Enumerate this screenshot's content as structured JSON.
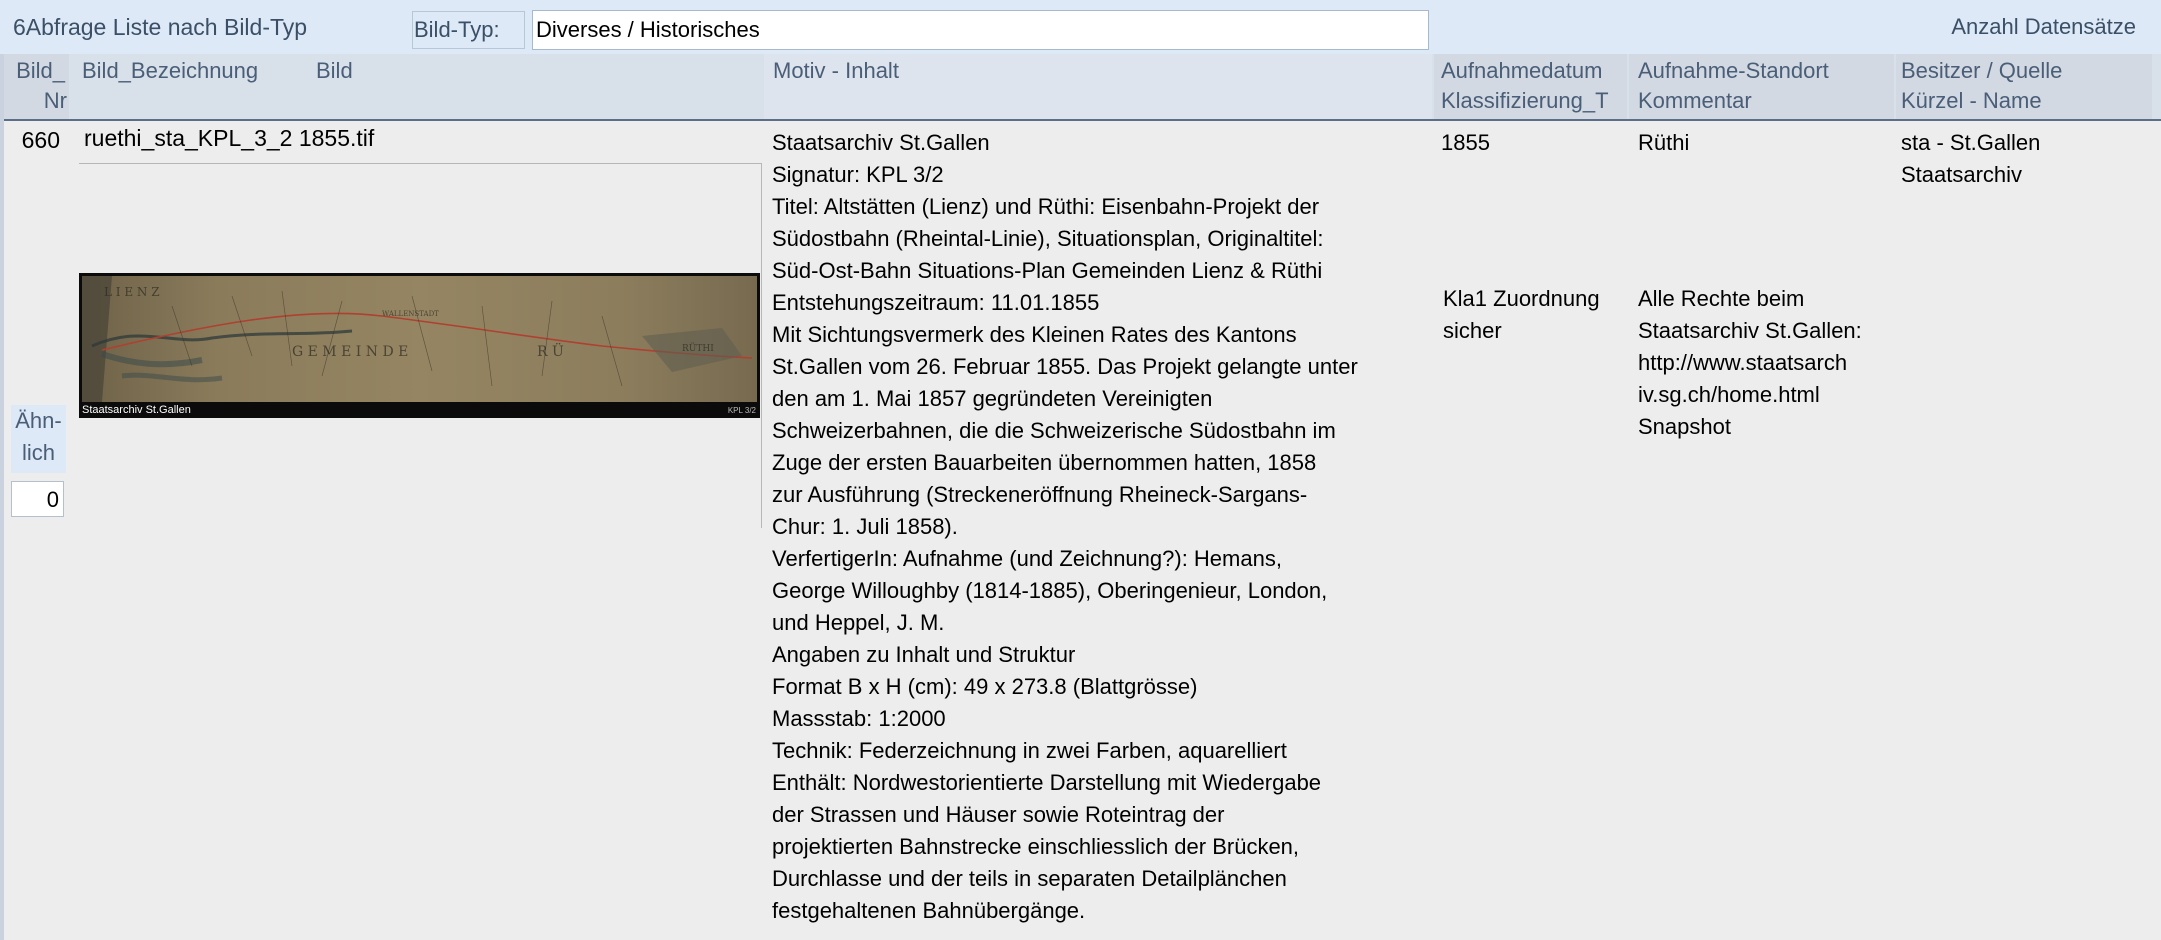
{
  "form": {
    "title": "6Abfrage Liste nach Bild-Typ",
    "filter_label": "Bild-Typ:",
    "filter_value": "Diverses / Historisches",
    "count_label": "Anzahl Datensätze"
  },
  "columns": {
    "bild_nr_line1": "Bild_",
    "bild_nr_line2": "Nr",
    "bezeichnung": "Bild_Bezeichnung",
    "bild": "Bild",
    "motiv": "Motiv - Inhalt",
    "datum": "Aufnahmedatum",
    "klassifizierung": "Klassifizierung_T",
    "standort": "Aufnahme-Standort",
    "kommentar": "Kommentar",
    "besitzer": "Besitzer / Quelle",
    "kuerzel": "Kürzel - Name"
  },
  "record": {
    "bild_nr": "660",
    "bezeichnung": "ruethi_sta_KPL_3_2 1855.tif",
    "image_caption": "Staatsarchiv St.Gallen",
    "image_caption_right": "KPL 3/2",
    "aehnlich_label_1": "Ähn-",
    "aehnlich_label_2": "lich",
    "aehnlich_value": "0",
    "motiv_lines": [
      "Staatsarchiv St.Gallen",
      "Signatur: KPL 3/2",
      "Titel: Altstätten (Lienz) und Rüthi: Eisenbahn-Projekt der",
      "Südostbahn (Rheintal-Linie), Situationsplan, Originaltitel:",
      "Süd-Ost-Bahn Situations-Plan Gemeinden Lienz & Rüthi",
      "Entstehungszeitraum: 11.01.1855",
      "Mit Sichtungsvermerk des Kleinen Rates des Kantons",
      "St.Gallen vom 26. Februar 1855. Das Projekt gelangte unter",
      "den am 1. Mai 1857 gegründeten Vereinigten",
      "Schweizerbahnen, die die Schweizerische Südostbahn im",
      "Zuge der ersten Bauarbeiten übernommen hatten, 1858",
      "zur Ausführung (Streckeneröffnung Rheineck-Sargans-",
      "Chur: 1. Juli 1858).",
      "VerfertigerIn: Aufnahme (und Zeichnung?): Hemans,",
      "George Willoughby (1814-1885), Oberingenieur, London,",
      "und Heppel, J. M.",
      "Angaben zu Inhalt und Struktur",
      "Format B x H (cm): 49 x 273.8 (Blattgrösse)",
      "Massstab: 1:2000",
      "Technik: Federzeichnung in zwei Farben, aquarelliert",
      "Enthält: Nordwestorientierte Darstellung mit Wiedergabe",
      "der Strassen und Häuser sowie Roteintrag der",
      "projektierten Bahnstrecke einschliesslich der Brücken,",
      "Durchlasse und der teils in separaten Detailplänchen",
      "festgehaltenen Bahnübergänge."
    ],
    "datum": "1855",
    "klassifizierung_1": "Kla1 Zuordnung",
    "klassifizierung_2": "sicher",
    "standort": "Rüthi",
    "kommentar_lines": [
      "Alle Rechte beim",
      "Staatsarchiv St.Gallen:",
      "http://www.staatsarch",
      "iv.sg.ch/home.html",
      "Snapshot"
    ],
    "besitzer_1": "sta - St.Gallen",
    "besitzer_2": "Staatsarchiv"
  },
  "colors": {
    "topbar": "#dde9f7",
    "header": "#d8e0ea",
    "detail": "#ededed",
    "label_text": "#4a5e78"
  }
}
